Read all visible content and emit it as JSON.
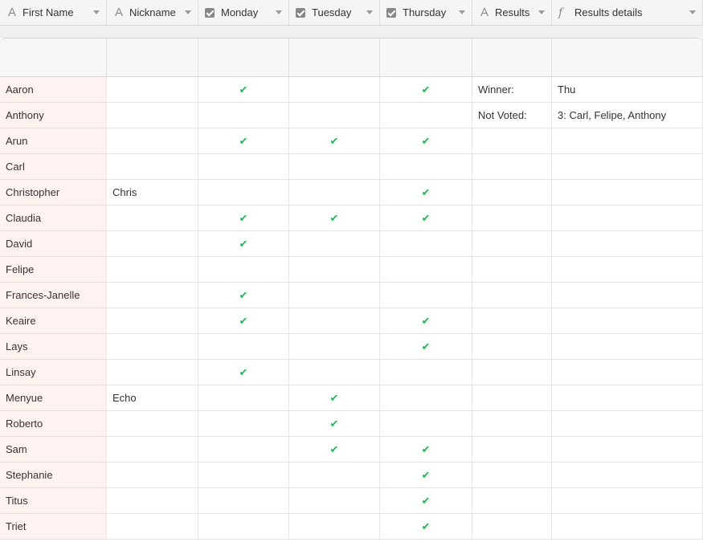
{
  "columns": [
    {
      "label": "First Name",
      "icon": "text-type-icon"
    },
    {
      "label": "Nickname",
      "icon": "text-type-icon"
    },
    {
      "label": "Monday",
      "icon": "checkbox-type-icon"
    },
    {
      "label": "Tuesday",
      "icon": "checkbox-type-icon"
    },
    {
      "label": "Thursday",
      "icon": "checkbox-type-icon"
    },
    {
      "label": "Results",
      "icon": "text-type-icon"
    },
    {
      "label": "Results details",
      "icon": "formula-type-icon"
    }
  ],
  "check_color": "#20b95a",
  "rows": [
    {
      "first_name": "Aaron",
      "nickname": "",
      "monday": true,
      "tuesday": false,
      "thursday": true,
      "results": "Winner:",
      "results_details": "Thu"
    },
    {
      "first_name": "Anthony",
      "nickname": "",
      "monday": false,
      "tuesday": false,
      "thursday": false,
      "results": "Not Voted:",
      "results_details": "3: Carl, Felipe, Anthony"
    },
    {
      "first_name": "Arun",
      "nickname": "",
      "monday": true,
      "tuesday": true,
      "thursday": true,
      "results": "",
      "results_details": ""
    },
    {
      "first_name": "Carl",
      "nickname": "",
      "monday": false,
      "tuesday": false,
      "thursday": false,
      "results": "",
      "results_details": ""
    },
    {
      "first_name": "Christopher",
      "nickname": "Chris",
      "monday": false,
      "tuesday": false,
      "thursday": true,
      "results": "",
      "results_details": ""
    },
    {
      "first_name": "Claudia",
      "nickname": "",
      "monday": true,
      "tuesday": true,
      "thursday": true,
      "results": "",
      "results_details": ""
    },
    {
      "first_name": "David",
      "nickname": "",
      "monday": true,
      "tuesday": false,
      "thursday": false,
      "results": "",
      "results_details": ""
    },
    {
      "first_name": "Felipe",
      "nickname": "",
      "monday": false,
      "tuesday": false,
      "thursday": false,
      "results": "",
      "results_details": ""
    },
    {
      "first_name": "Frances-Janelle",
      "nickname": "",
      "monday": true,
      "tuesday": false,
      "thursday": false,
      "results": "",
      "results_details": ""
    },
    {
      "first_name": "Keaire",
      "nickname": "",
      "monday": true,
      "tuesday": false,
      "thursday": true,
      "results": "",
      "results_details": ""
    },
    {
      "first_name": "Lays",
      "nickname": "",
      "monday": false,
      "tuesday": false,
      "thursday": true,
      "results": "",
      "results_details": ""
    },
    {
      "first_name": "Linsay",
      "nickname": "",
      "monday": true,
      "tuesday": false,
      "thursday": false,
      "results": "",
      "results_details": ""
    },
    {
      "first_name": "Menyue",
      "nickname": "Echo",
      "monday": false,
      "tuesday": true,
      "thursday": false,
      "results": "",
      "results_details": ""
    },
    {
      "first_name": "Roberto",
      "nickname": "",
      "monday": false,
      "tuesday": true,
      "thursday": false,
      "results": "",
      "results_details": ""
    },
    {
      "first_name": "Sam",
      "nickname": "",
      "monday": false,
      "tuesday": true,
      "thursday": true,
      "results": "",
      "results_details": ""
    },
    {
      "first_name": "Stephanie",
      "nickname": "",
      "monday": false,
      "tuesday": false,
      "thursday": true,
      "results": "",
      "results_details": ""
    },
    {
      "first_name": "Titus",
      "nickname": "",
      "monday": false,
      "tuesday": false,
      "thursday": true,
      "results": "",
      "results_details": ""
    },
    {
      "first_name": "Triet",
      "nickname": "",
      "monday": false,
      "tuesday": false,
      "thursday": true,
      "results": "",
      "results_details": ""
    }
  ]
}
